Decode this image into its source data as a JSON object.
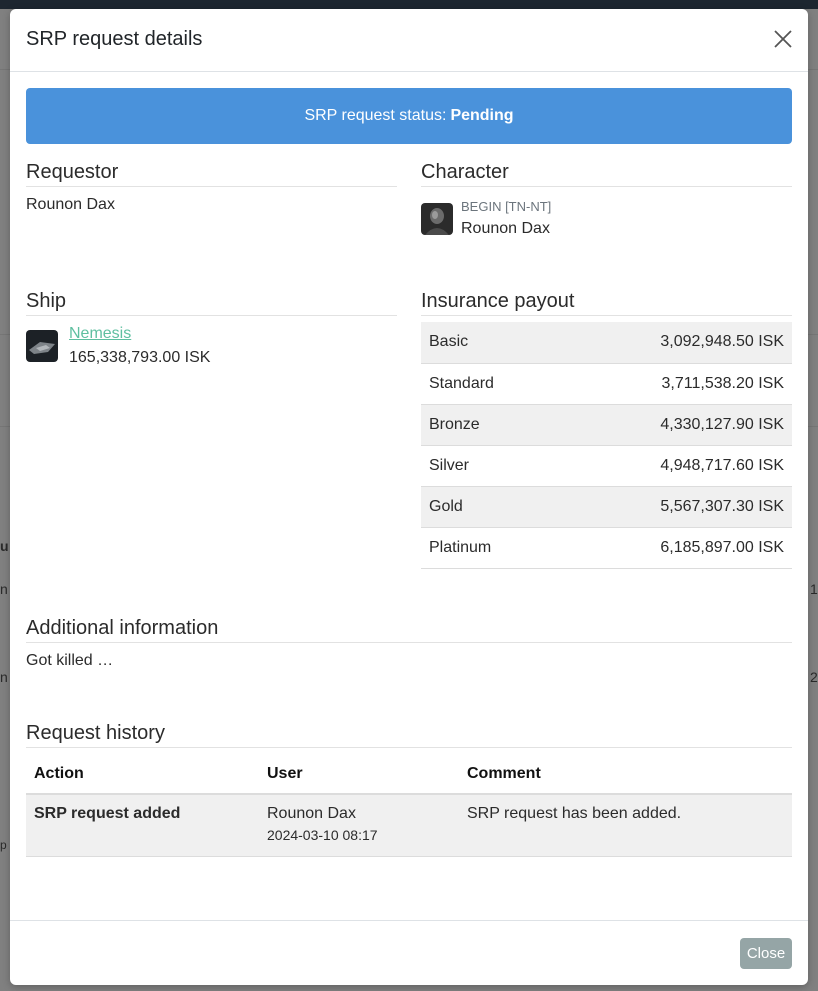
{
  "modal": {
    "title": "SRP request details",
    "status_prefix": "SRP request status:",
    "status_value": "Pending",
    "close_label": "Close"
  },
  "requestor": {
    "heading": "Requestor",
    "name": "Rounon Dax"
  },
  "character": {
    "heading": "Character",
    "corp": "BEGIN [TN-NT]",
    "name": "Rounon Dax"
  },
  "ship": {
    "heading": "Ship",
    "name": "Nemesis",
    "value": "165,338,793.00 ISK"
  },
  "insurance": {
    "heading": "Insurance payout",
    "rows": [
      {
        "level": "Basic",
        "payout": "3,092,948.50 ISK"
      },
      {
        "level": "Standard",
        "payout": "3,711,538.20 ISK"
      },
      {
        "level": "Bronze",
        "payout": "4,330,127.90 ISK"
      },
      {
        "level": "Silver",
        "payout": "4,948,717.60 ISK"
      },
      {
        "level": "Gold",
        "payout": "5,567,307.30 ISK"
      },
      {
        "level": "Platinum",
        "payout": "6,185,897.00 ISK"
      }
    ]
  },
  "additional_info": {
    "heading": "Additional information",
    "text": "Got killed …"
  },
  "history": {
    "heading": "Request history",
    "columns": [
      "Action",
      "User",
      "Comment"
    ],
    "rows": [
      {
        "action": "SRP request added",
        "user": "Rounon Dax",
        "date": "2024-03-10 08:17",
        "comment": "SRP request has been added."
      }
    ]
  },
  "background": {
    "fragments": [
      "u",
      "n",
      "1",
      "n",
      "2",
      "p"
    ]
  },
  "colors": {
    "status_banner": "#4a92db",
    "link": "#5fbfa0",
    "close_button": "#95a5a6"
  }
}
